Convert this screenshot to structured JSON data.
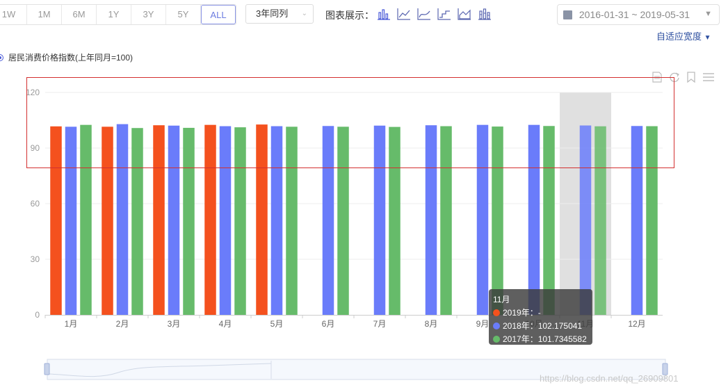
{
  "toolbar": {
    "ranges": [
      {
        "label": "1W",
        "active": false
      },
      {
        "label": "1M",
        "active": false
      },
      {
        "label": "6M",
        "active": false
      },
      {
        "label": "1Y",
        "active": false
      },
      {
        "label": "3Y",
        "active": false
      },
      {
        "label": "5Y",
        "active": false
      },
      {
        "label": "ALL",
        "active": true
      }
    ],
    "compare_select": "3年同列",
    "chart_type_label": "图表展示：",
    "chart_type_icons": [
      "bar-chart-icon",
      "line-chart-icon",
      "smooth-line-icon",
      "step-line-icon",
      "area-chart-icon",
      "stacked-bar-icon"
    ],
    "date_range": "2016-01-31 ~ 2019-05-31"
  },
  "adapt_width": "自适应宽度",
  "legend": {
    "label": "居民消费价格指数(上年同月=100)"
  },
  "tools_icons": [
    "data-view-icon",
    "restore-icon",
    "save-image-icon",
    "menu-icon"
  ],
  "colors": {
    "s2019": "#f4511e",
    "s2018": "#6a7cfa",
    "s2017": "#66bb6a",
    "highlight": "#e0e0e0",
    "annotation": "#d32f2f"
  },
  "chart_data": {
    "type": "bar",
    "categories": [
      "1月",
      "2月",
      "3月",
      "4月",
      "5月",
      "6月",
      "7月",
      "8月",
      "9月",
      "10月",
      "11月",
      "12月"
    ],
    "series": [
      {
        "name": "2019年",
        "values": [
          101.7,
          101.5,
          102.3,
          102.5,
          102.7,
          null,
          null,
          null,
          null,
          null,
          null,
          null
        ]
      },
      {
        "name": "2018年",
        "values": [
          101.5,
          102.9,
          102.1,
          101.8,
          101.8,
          101.9,
          102.1,
          102.3,
          102.5,
          102.5,
          102.175041,
          101.9
        ]
      },
      {
        "name": "2017年",
        "values": [
          102.5,
          100.8,
          100.9,
          101.2,
          101.5,
          101.5,
          101.4,
          101.8,
          101.6,
          101.9,
          101.7345582,
          101.8
        ]
      }
    ],
    "yticks": [
      0,
      30,
      60,
      90,
      120
    ],
    "ylim": [
      0,
      120
    ],
    "grid": true,
    "highlight_category": "11月"
  },
  "tooltip": {
    "title": "11月",
    "rows": [
      {
        "label": "2019年：-"
      },
      {
        "label": "2018年：102.175041"
      },
      {
        "label": "2017年：101.7345582"
      }
    ]
  },
  "watermark": "https://blog.csdn.net/qq_26909801"
}
